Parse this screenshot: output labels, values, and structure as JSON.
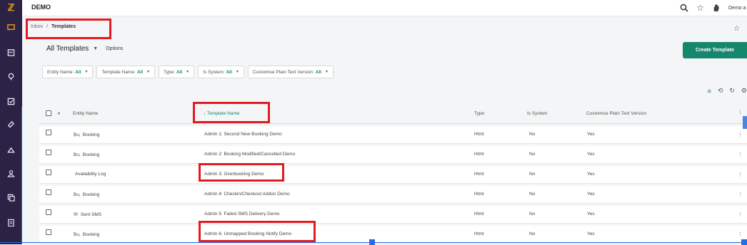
{
  "app": {
    "title": "DEMO",
    "user_label": "Demo a"
  },
  "icons": {
    "logo": "logo-icon",
    "sidebar": [
      "inbox-icon",
      "calendar-icon",
      "location-icon",
      "checklist-icon",
      "tag-icon",
      "home-icon",
      "users-icon",
      "pages-icon",
      "clipboard-icon"
    ],
    "topbar": [
      "search-icon",
      "star-icon",
      "hand-icon"
    ]
  },
  "breadcrumb": {
    "parent": "Inbox",
    "separator": "/",
    "current": "Templates"
  },
  "toolbar": {
    "view_title": "All Templates",
    "options_label": "Options",
    "create_label": "Create Template"
  },
  "filters": [
    {
      "label": "Entity Name:",
      "value": "All"
    },
    {
      "label": "Template Name:",
      "value": "All"
    },
    {
      "label": "Type:",
      "value": "All"
    },
    {
      "label": "Is System:",
      "value": "All"
    },
    {
      "label": "Customise Plain Text Version:",
      "value": "All"
    }
  ],
  "columns": {
    "entity": "Entity Name",
    "template": "Template Name",
    "type": "Type",
    "system": "Is System",
    "plain": "Customise Plain Text Version"
  },
  "sort": {
    "arrow": "↓"
  },
  "rows": [
    {
      "entity": "Booking",
      "entity_icon": "bed-icon",
      "template": "Admin 1: Second New Booking Demo",
      "type": "Html",
      "system": "No",
      "plain": "Yes"
    },
    {
      "entity": "Booking",
      "entity_icon": "bed-icon",
      "template": "Admin 2: Booking Modified/Cancelled Demo",
      "type": "Html",
      "system": "No",
      "plain": "Yes"
    },
    {
      "entity": "Availability Log",
      "entity_icon": "",
      "template": "Admin 3: Overbooking Demo",
      "type": "Html",
      "system": "No",
      "plain": "Yes"
    },
    {
      "entity": "Booking",
      "entity_icon": "bed-icon",
      "template": "Admin 4: Checkin/Checkout Addon Demo",
      "type": "Html",
      "system": "No",
      "plain": "Yes"
    },
    {
      "entity": "Sent SMS",
      "entity_icon": "envelope-icon",
      "template": "Admin 5: Failed SMS Delivery Demo",
      "type": "Html",
      "system": "No",
      "plain": "Yes"
    },
    {
      "entity": "Booking",
      "entity_icon": "bed-icon",
      "template": "Admin 6: Unmapped Booking Notify Demo",
      "type": "Html",
      "system": "No",
      "plain": "Yes"
    }
  ],
  "colors": {
    "accent": "#16876f",
    "sidebar": "#2b2245",
    "highlight": "#e11b22",
    "selection": "#2a6cdf"
  }
}
